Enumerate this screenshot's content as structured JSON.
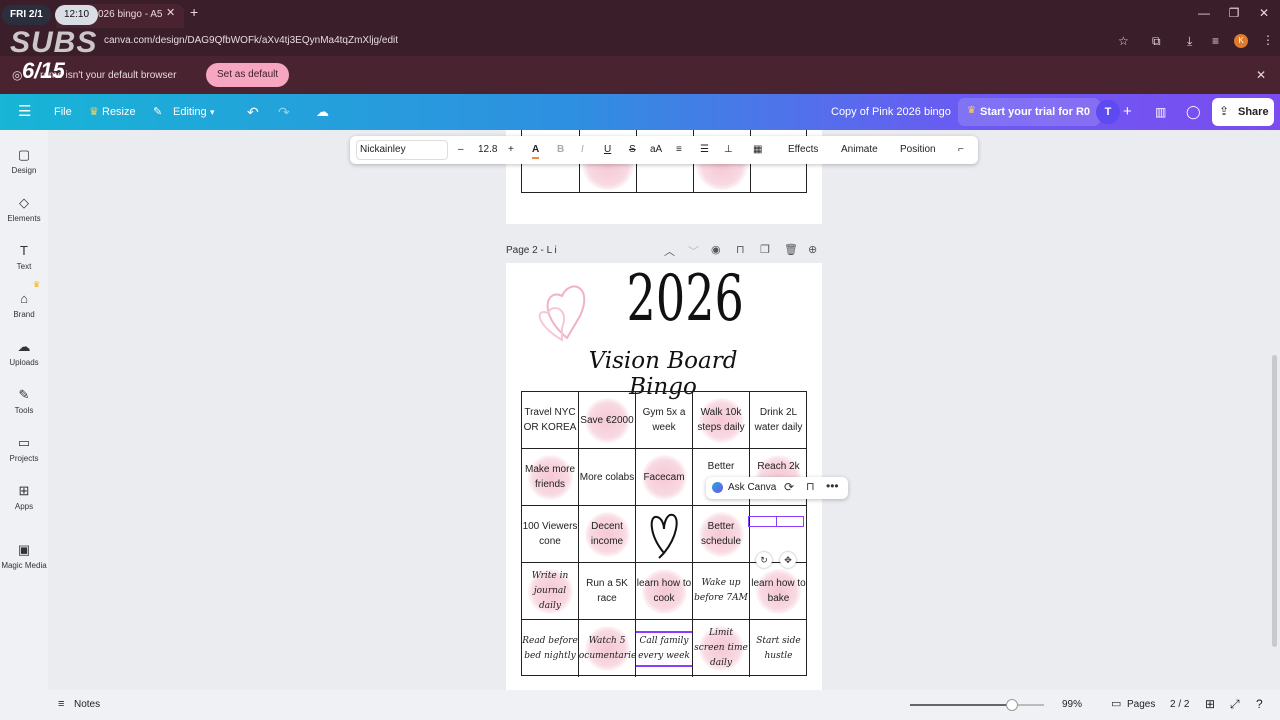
{
  "overlay": {
    "day": "FRI 2/1",
    "time": "12:10",
    "subs": "SUBS",
    "subs_count": "6/15"
  },
  "browser": {
    "tab_title": "026 bingo - A5",
    "url": "canva.com/design/DAG9QfbWOFk/aXv4tj3EQynMa4tqZmXljg/edit",
    "info_text": "rome isn't your default browser",
    "set_default_label": "Set as default",
    "profile_letter": "K"
  },
  "header": {
    "file": "File",
    "resize": "Resize",
    "editing": "Editing",
    "doc_title": "Copy of Pink 2026 bingo",
    "trial": "Start your trial for R0",
    "avatar_letter": "T",
    "share": "Share"
  },
  "sidebar": {
    "items": [
      {
        "label": "Design",
        "icon": "design-icon"
      },
      {
        "label": "Elements",
        "icon": "elements-icon"
      },
      {
        "label": "Text",
        "icon": "text-icon"
      },
      {
        "label": "Brand",
        "icon": "brand-icon"
      },
      {
        "label": "Uploads",
        "icon": "uploads-icon"
      },
      {
        "label": "Tools",
        "icon": "tools-icon"
      },
      {
        "label": "Projects",
        "icon": "projects-icon"
      },
      {
        "label": "Apps",
        "icon": "apps-icon"
      },
      {
        "label": "Magic Media",
        "icon": "magic-media-icon"
      }
    ]
  },
  "toolbar": {
    "font": "Nickainley",
    "size": "12.8",
    "effects": "Effects",
    "animate": "Animate",
    "position": "Position"
  },
  "page2": {
    "label": "Page 2 - L i",
    "year": "2026",
    "subtitle": "Vision Board Bingo"
  },
  "ask_canva": "Ask Canva",
  "bingo": {
    "cells": [
      "Travel NYC OR KOREA",
      "Save €2000",
      "Gym 5x a week",
      "Walk 10k steps daily",
      "Drink 2L water daily",
      "Make more friends",
      "More colabs",
      "Facecam",
      "Better",
      "Reach 2k",
      "100 Viewers cone",
      "Decent income",
      "",
      "Better schedule",
      "",
      "Write in journal daily",
      "Run a 5K race",
      "learn how to cook",
      "Wake up before 7AM",
      "learn how to bake",
      "Read before bed nightly",
      "Watch 5 documentaries",
      "Call family every week",
      "Limit screen time daily",
      "Start side hustle"
    ]
  },
  "bottom": {
    "notes": "Notes",
    "zoom": "99%",
    "pages": "Pages",
    "page_count": "2 / 2",
    "zoom_level": 0.76
  },
  "colors": {
    "accent": "#7b4cf0",
    "pink": "#f6a6c0"
  }
}
